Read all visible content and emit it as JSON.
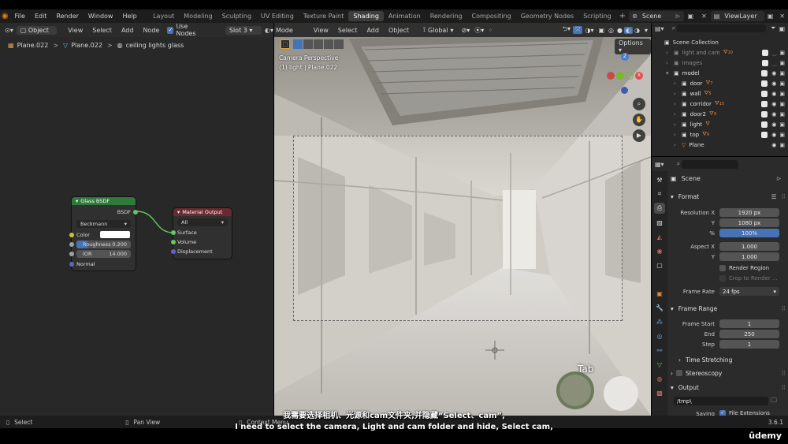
{
  "menu": [
    "File",
    "Edit",
    "Render",
    "Window",
    "Help"
  ],
  "workspaces": [
    "Layout",
    "Modeling",
    "Sculpting",
    "UV Editing",
    "Texture Paint",
    "Shading",
    "Animation",
    "Rendering",
    "Compositing",
    "Geometry Nodes",
    "Scripting"
  ],
  "active_workspace": "Shading",
  "scene_name": "Scene",
  "view_layer": "ViewLayer",
  "node_header": {
    "object_mode": "Object",
    "items": [
      "View",
      "Select",
      "Add",
      "Node"
    ],
    "use_nodes": "Use Nodes",
    "slot": "Slot 3"
  },
  "breadcrumb": [
    "Plane.022",
    "Plane.022",
    "ceiling lights glass"
  ],
  "glass_node": {
    "title": "Glass BSDF",
    "output": "BSDF",
    "distribution": "Beckmann",
    "color_label": "Color",
    "roughness_label": "Roughness",
    "roughness": "0.200",
    "ior_label": "IOR",
    "ior": "14.000",
    "normal_label": "Normal"
  },
  "output_node": {
    "title": "Material Output",
    "target": "All",
    "inputs": [
      "Surface",
      "Volume",
      "Displacement"
    ]
  },
  "viewport": {
    "mode": "Mode",
    "items": [
      "View",
      "Select",
      "Add",
      "Object"
    ],
    "transform": "Global",
    "options": "Options",
    "camera_label": "Camera Perspective",
    "object_label": "(1) light | Plane.022",
    "key_overlay": "Tab"
  },
  "outliner": {
    "root": "Scene Collection",
    "rows": [
      {
        "name": "light and cam",
        "depth": 1,
        "dim": true,
        "count": "10",
        "eye": false
      },
      {
        "name": "images",
        "depth": 1,
        "dim": true,
        "count": "",
        "eye": false
      },
      {
        "name": "model",
        "depth": 1,
        "dim": false,
        "count": "",
        "eye": true
      },
      {
        "name": "door",
        "depth": 2,
        "dim": false,
        "count": "7",
        "eye": true
      },
      {
        "name": "wall",
        "depth": 2,
        "dim": false,
        "count": "5",
        "eye": true
      },
      {
        "name": "corridor",
        "depth": 2,
        "dim": false,
        "count": "15",
        "eye": true
      },
      {
        "name": "door2",
        "depth": 2,
        "dim": false,
        "count": "9",
        "eye": true
      },
      {
        "name": "light",
        "depth": 2,
        "dim": false,
        "count": "",
        "eye": true
      },
      {
        "name": "top",
        "depth": 2,
        "dim": false,
        "count": "6",
        "eye": true
      },
      {
        "name": "Plane",
        "depth": 2,
        "dim": false,
        "count": "",
        "eye": true
      }
    ]
  },
  "properties": {
    "scene": "Scene",
    "format_section": "Format",
    "resolution_x_label": "Resolution X",
    "resolution_x": "1920 px",
    "y_label": "Y",
    "resolution_y": "1080 px",
    "percent_label": "%",
    "percent": "100%",
    "aspect_x_label": "Aspect X",
    "aspect_x": "1.000",
    "aspect_y": "1.000",
    "render_region": "Render Region",
    "crop": "Crop to Render ...",
    "frame_rate_label": "Frame Rate",
    "frame_rate": "24 fps",
    "frame_range_section": "Frame Range",
    "frame_start_label": "Frame Start",
    "frame_start": "1",
    "end_label": "End",
    "frame_end": "250",
    "step_label": "Step",
    "step": "1",
    "time_stretching": "Time Stretching",
    "stereoscopy": "Stereoscopy",
    "output_section": "Output",
    "output_path": "/tmp\\",
    "saving_label": "Saving",
    "file_extensions": "File Extensions"
  },
  "statusbar": {
    "select": "Select",
    "pan_view": "Pan View",
    "context_menu": "Context Menu",
    "version": "3.6.1"
  },
  "subtitles": {
    "chinese": "我需要选择相机、光源和cam文件夹,并隐藏“Select、cam”,",
    "english": "I need to select the camera, Light and cam folder and hide, Select cam,"
  },
  "watermark": "ûdemy",
  "colors": {
    "glass_header": "#2f7a3b",
    "output_header": "#6b2a2f",
    "active_field": "#4772b3",
    "green_socket": "#63c763",
    "grey_socket": "#a1a1a1",
    "blue_socket": "#6363c7"
  }
}
